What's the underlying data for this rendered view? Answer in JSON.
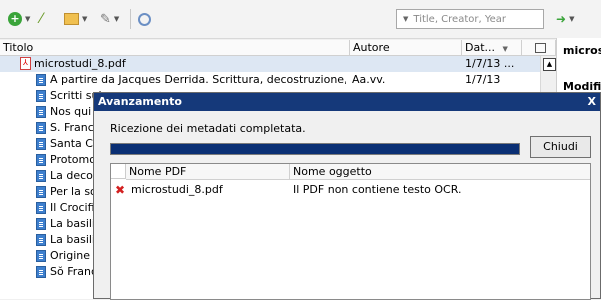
{
  "toolbar": {
    "search_placeholder": "Title, Creator, Year",
    "icons": [
      "add-circle-icon",
      "magic-wand-icon",
      "folder-new-icon",
      "pen-icon",
      "search-icon",
      "locate-icon"
    ]
  },
  "table": {
    "headers": {
      "title": "Titolo",
      "author": "Autore",
      "date": "Dat...",
      "date_sort": "▼"
    },
    "rows": [
      {
        "title": "microstudi_8.pdf",
        "author": "",
        "date": "1/7/13 ...",
        "kind": "pdf"
      },
      {
        "title": "A partire da Jacques Derrida. Scrittura, decostruzione, ospitalit...",
        "author": "Aa.vv.",
        "date": "1/7/13",
        "kind": "doc"
      },
      {
        "title": "Scritti sul",
        "kind": "doc"
      },
      {
        "title": "Nos qui c",
        "kind": "doc"
      },
      {
        "title": "S. France",
        "kind": "doc"
      },
      {
        "title": "Santa Ch",
        "kind": "doc"
      },
      {
        "title": "Protomor",
        "kind": "doc"
      },
      {
        "title": "La decora",
        "kind": "doc"
      },
      {
        "title": "Per la sol",
        "kind": "doc"
      },
      {
        "title": "Il Crocifis",
        "kind": "doc"
      },
      {
        "title": "La basilica",
        "kind": "doc"
      },
      {
        "title": "La basilica",
        "kind": "doc"
      },
      {
        "title": "Origine e",
        "kind": "doc"
      },
      {
        "title": "Sŏ Franci",
        "kind": "doc"
      }
    ]
  },
  "right_pane": {
    "title": "microst",
    "label": "Modific"
  },
  "dialog": {
    "title": "Avanzamento",
    "close": "X",
    "message": "Ricezione dei metadati completata.",
    "progress": 1.0,
    "button": "Chiudi",
    "columns": {
      "pdf": "Nome PDF",
      "item": "Nome oggetto"
    },
    "rows": [
      {
        "pdf": "microstudi_8.pdf",
        "item": "Il PDF non contiene testo OCR."
      }
    ]
  },
  "colors": {
    "titlebar": "#15397a",
    "progress": "#0a2f74",
    "selection": "#dde7f3"
  }
}
